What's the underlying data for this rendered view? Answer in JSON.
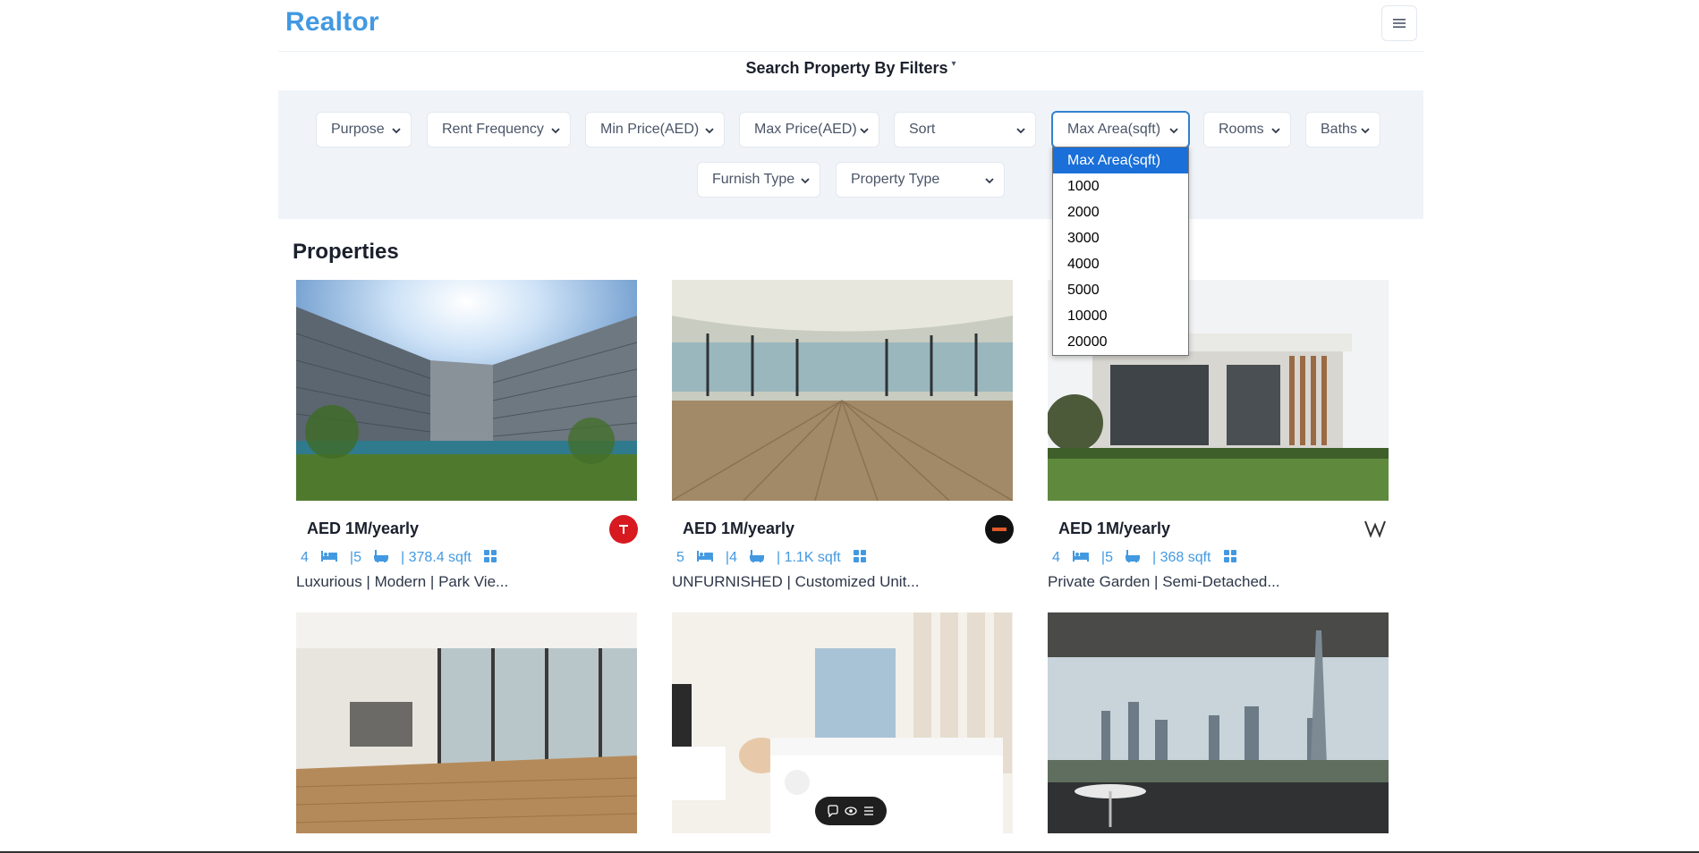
{
  "brand": {
    "title": "Realtor"
  },
  "filters": {
    "heading": "Search Property By Filters",
    "selects": [
      {
        "label": "Purpose"
      },
      {
        "label": "Rent Frequency"
      },
      {
        "label": "Min Price(AED)"
      },
      {
        "label": "Max Price(AED)"
      },
      {
        "label": "Sort"
      },
      {
        "label": "Max Area(sqft)"
      },
      {
        "label": "Rooms"
      },
      {
        "label": "Baths"
      },
      {
        "label": "Furnish Type"
      },
      {
        "label": "Property Type"
      }
    ],
    "open_dropdown": {
      "label": "Max Area(sqft)",
      "options": [
        "Max Area(sqft)",
        "1000",
        "2000",
        "3000",
        "4000",
        "5000",
        "10000",
        "20000"
      ],
      "selected": "Max Area(sqft)"
    }
  },
  "properties": {
    "heading": "Properties",
    "cards": [
      {
        "price": "AED 1M/yearly",
        "rooms": "4",
        "baths": "|5",
        "area": "| 378.4 sqft",
        "title": "Luxurious | Modern | Park Vie...",
        "agency_color": "#d71920"
      },
      {
        "price": "AED 1M/yearly",
        "rooms": "5",
        "baths": "|4",
        "area": "| 1.1K sqft",
        "title": "UNFURNISHED | Customized Unit...",
        "agency_color": "#111111"
      },
      {
        "price": "AED 1M/yearly",
        "rooms": "4",
        "baths": "|5",
        "area": "| 368 sqft",
        "title": "Private Garden | Semi-Detached...",
        "agency_color": "#ffffff"
      },
      {
        "price": "",
        "rooms": "",
        "baths": "",
        "area": "",
        "title": ""
      },
      {
        "price": "",
        "rooms": "",
        "baths": "",
        "area": "",
        "title": ""
      },
      {
        "price": "",
        "rooms": "",
        "baths": "",
        "area": "",
        "title": ""
      }
    ]
  },
  "colors": {
    "brand": "#4299e1",
    "panel_bg": "#f0f4f8",
    "accent": "#3182ce",
    "dropdown_selected": "#1a6fd8"
  }
}
